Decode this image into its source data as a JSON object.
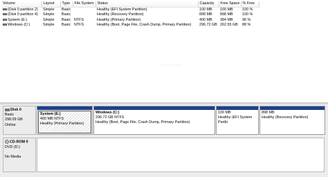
{
  "columns": [
    "Volume",
    "Layout",
    "Type",
    "File System",
    "Status",
    "Capacity",
    "Free Space",
    "% Free"
  ],
  "volumes": [
    {
      "volume": "(Disk 0 partition 2)",
      "layout": "Simple",
      "type": "Basic",
      "fs": "",
      "status": "Healthy (EFI System Partition)",
      "capacity": "100 MB",
      "free": "100 MB",
      "pct": "100 %"
    },
    {
      "volume": "(Disk 0 partition 4)",
      "layout": "Simple",
      "type": "Basic",
      "fs": "",
      "status": "Healthy (Recovery Partition)",
      "capacity": "898 MB",
      "free": "898 MB",
      "pct": "100 %"
    },
    {
      "volume": "System (E:)",
      "layout": "Simple",
      "type": "Basic",
      "fs": "NTFS",
      "status": "Healthy (Primary Partition)",
      "capacity": "400 MB",
      "free": "384 MB",
      "pct": "96 %"
    },
    {
      "volume": "Windows (C:)",
      "layout": "Simple",
      "type": "Basic",
      "fs": "NTFS",
      "status": "Healthy (Boot, Page File, Crash Dump, Primary Partition)",
      "capacity": "296.72 GB",
      "free": "262.55 GB",
      "pct": "88 %"
    }
  ],
  "disk0": {
    "name": "Disk 0",
    "type": "Basic",
    "size": "298.09 GB",
    "state": "Online",
    "partitions": [
      {
        "name": "System  (E:)",
        "size": "400 MB NTFS",
        "status": "Healthy (Primary Partition)"
      },
      {
        "name": "Windows  (C:)",
        "size": "296.72 GB NTFS",
        "status": "Healthy (Boot, Page File, Crash Dump, Primary Partition)"
      },
      {
        "name": "",
        "size": "100 MB",
        "status": "Healthy (EFI System Partiti"
      },
      {
        "name": "",
        "size": "898 MB",
        "status": "Healthy (Recovery Partition)"
      }
    ]
  },
  "cdrom": {
    "name": "CD-ROM 0",
    "drive": "DVD (D:)",
    "media": "No Media"
  },
  "ghost_text": "Recover Data"
}
